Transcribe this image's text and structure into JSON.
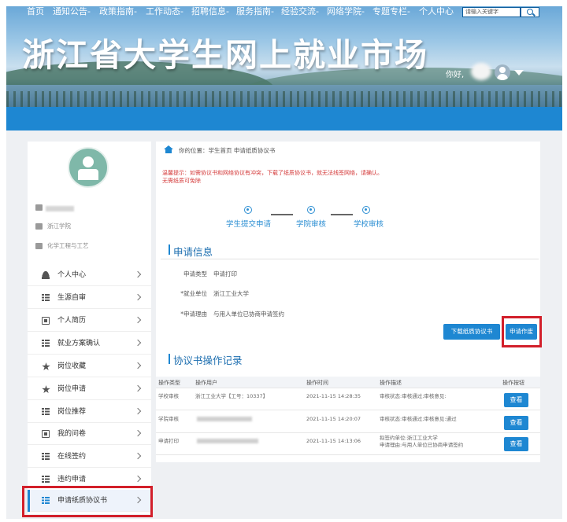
{
  "header": {
    "site_title": "浙江省大学生网上就业市场",
    "greeting": "你好,"
  },
  "nav": {
    "items": [
      "首页",
      "通知公告-",
      "政策指南-",
      "工作动态-",
      "招聘信息-",
      "服务指南-",
      "经验交流-",
      "网络学院-",
      "专题专栏-",
      "个人中心"
    ],
    "search_placeholder": "请输入关键字"
  },
  "sidebar": {
    "meta": [
      "浙江学院",
      "化学工程与工艺"
    ],
    "menu": [
      {
        "label": "个人中心",
        "icon": "person-icon"
      },
      {
        "label": "生源自审",
        "icon": "list-icon"
      },
      {
        "label": "个人简历",
        "icon": "document-icon"
      },
      {
        "label": "就业方案确认",
        "icon": "list-icon"
      },
      {
        "label": "岗位收藏",
        "icon": "star-icon"
      },
      {
        "label": "岗位申请",
        "icon": "star-icon"
      },
      {
        "label": "岗位推荐",
        "icon": "list-icon"
      },
      {
        "label": "我的问卷",
        "icon": "document-icon"
      },
      {
        "label": "在线签约",
        "icon": "list-icon"
      },
      {
        "label": "违约申请",
        "icon": "list-icon"
      },
      {
        "label": "申请纸质协议书",
        "icon": "list-icon"
      }
    ]
  },
  "content": {
    "breadcrumb": "你的位置：学生首页 申请纸质协议书",
    "notice": "温馨提示：如需协议书和网络协议有冲突，下载了纸质协议书，就无法线签网络，请确认。无需纸质可免除",
    "steps": [
      "学生提交申请",
      "学院审核",
      "学校审核"
    ],
    "apply_info": {
      "title": "申请信息",
      "fields": [
        {
          "label": "申请类型",
          "value": "申请打印"
        },
        {
          "label": "*就业单位",
          "value": "浙江工业大学"
        },
        {
          "label": "*申请理由",
          "value": "与用人单位已协商申请签约"
        }
      ]
    },
    "buttons": {
      "download": "下载纸质协议书",
      "void": "申请作废"
    },
    "records": {
      "title": "协议书操作记录",
      "headers": [
        "操作类型",
        "操作用户",
        "操作时间",
        "操作描述",
        "操作按钮"
      ],
      "rows": [
        {
          "type": "学校审核",
          "user": "浙江工业大学【工号：10337】",
          "time": "2021-11-15 14:28:35",
          "desc": "审核状态:审核通过;审核意见:",
          "action": "查看"
        },
        {
          "type": "学院审核",
          "user": "",
          "time": "2021-11-15 14:20:07",
          "desc": "审核状态:审核通过;审核意见:通过",
          "action": "查看"
        },
        {
          "type": "申请打印",
          "user": "",
          "time": "2021-11-15 14:13:06",
          "desc": "拟签约单位:浙江工业大学",
          "desc2": "申请理由:与用人单位已协商申请签约",
          "action": "查看"
        }
      ]
    }
  }
}
